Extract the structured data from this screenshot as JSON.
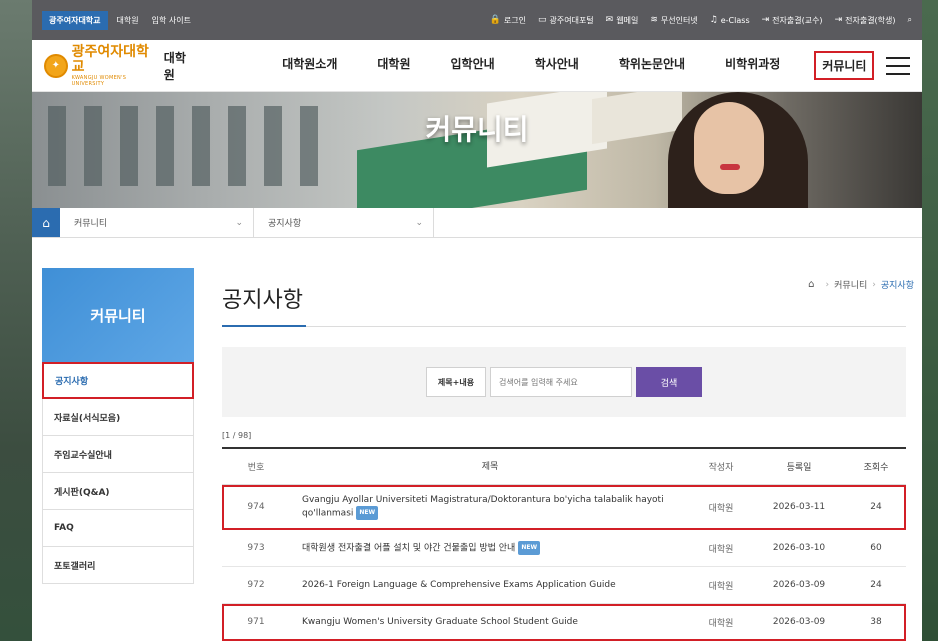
{
  "topbar": {
    "left": [
      "광주여자대학교",
      "대학원",
      "입학 사이트"
    ],
    "right": [
      {
        "icon": "lock-icon",
        "glyph": "🔒",
        "label": "로그인"
      },
      {
        "icon": "monitor-icon",
        "glyph": "▭",
        "label": "광주여대포털"
      },
      {
        "icon": "mail-icon",
        "glyph": "✉",
        "label": "웹메일"
      },
      {
        "icon": "wifi-icon",
        "glyph": "≋",
        "label": "무선인터넷"
      },
      {
        "icon": "eclass-icon",
        "glyph": "♫",
        "label": "e-Class"
      },
      {
        "icon": "login-icon",
        "glyph": "⇥",
        "label": "전자출결(교수)"
      },
      {
        "icon": "login-icon",
        "glyph": "⇥",
        "label": "전자출결(학생)"
      }
    ],
    "search_glyph": "⌕"
  },
  "header": {
    "logo_ko": "광주여자대학교",
    "logo_en": "KWANGJU WOMEN'S UNIVERSITY",
    "logo_sub": "대학원",
    "nav": [
      "대학원소개",
      "대학원",
      "입학안내",
      "학사안내",
      "학위논문안내",
      "비학위과정",
      "커뮤니티"
    ]
  },
  "hero": {
    "title": "커뮤니티"
  },
  "breadcrumb": {
    "home_glyph": "⌂",
    "level1": "커뮤니티",
    "level2": "공지사항",
    "chev": "⌄"
  },
  "sidebar": {
    "title": "커뮤니티",
    "items": [
      "공지사항",
      "자료실(서식모음)",
      "주임교수실안내",
      "게시판(Q&A)",
      "FAQ",
      "포토갤러리"
    ]
  },
  "main": {
    "title": "공지사항",
    "path": [
      "커뮤니티",
      "공지사항"
    ],
    "path_sep": "›"
  },
  "search": {
    "category": "제목+내용",
    "placeholder": "검색어를 입력해 주세요",
    "button": "검색"
  },
  "board": {
    "count": "[1 / 98]",
    "headers": [
      "번호",
      "제목",
      "작성자",
      "등록일",
      "조회수"
    ],
    "new_badge": "NEW",
    "rows": [
      {
        "no": "974",
        "title": "Gvangju Ayollar Universiteti Magistratura/Doktorantura bo'yicha talabalik hayoti qo'llanmasi",
        "author": "대학원",
        "date": "2026-03-11",
        "views": "24",
        "is_new": true
      },
      {
        "no": "973",
        "title": "대학원생 전자출결 어플 설치 및 야간 건물출입 방법 안내",
        "author": "대학원",
        "date": "2026-03-10",
        "views": "60",
        "is_new": true
      },
      {
        "no": "972",
        "title": "2026-1 Foreign Language & Comprehensive Exams Application Guide",
        "author": "대학원",
        "date": "2026-03-09",
        "views": "24",
        "is_new": false
      },
      {
        "no": "971",
        "title": "Kwangju Women's University Graduate School Student Guide",
        "author": "대학원",
        "date": "2026-03-09",
        "views": "38",
        "is_new": false
      }
    ]
  },
  "colors": {
    "accent": "#2b6cb0",
    "highlight": "#d21f26",
    "search_button": "#6a4ea6",
    "logo": "#e08a00"
  }
}
